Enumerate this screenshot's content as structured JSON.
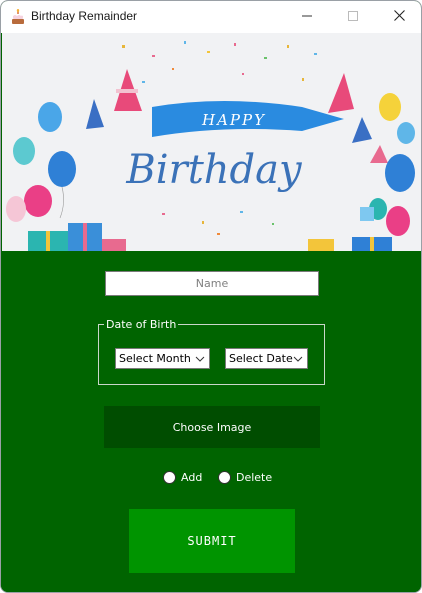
{
  "window": {
    "title": "Birthday Remainder",
    "controls": {
      "minimize": "minimize-icon",
      "maximize": "maximize-icon",
      "close": "close-icon"
    }
  },
  "banner": {
    "line1": "HAPPY",
    "line2": "Birthday"
  },
  "form": {
    "name_placeholder": "Name",
    "name_value": "",
    "dob_legend": "Date of Birth",
    "month_select": "Select Month",
    "date_select": "Select Date",
    "choose_image": "Choose Image",
    "radio_add": "Add",
    "radio_delete": "Delete",
    "submit": "SUBMIT"
  },
  "colors": {
    "background_green": "#006400",
    "choose_button": "#004d00",
    "submit_button": "#009400",
    "banner_ribbon": "#2a8be0",
    "birthday_text": "#3b72b8"
  }
}
